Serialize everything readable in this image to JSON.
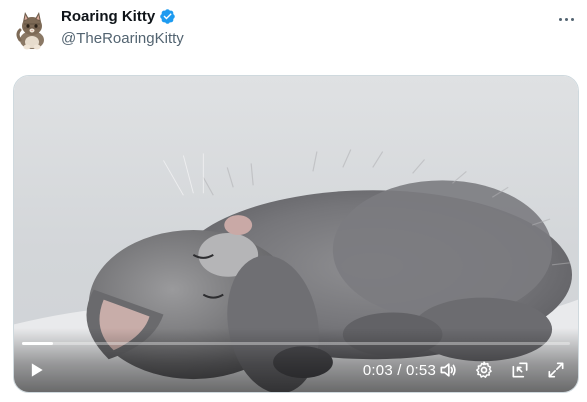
{
  "author": {
    "name": "Roaring Kitty",
    "handle": "@TheRoaringKitty",
    "verified": true,
    "verified_color": "#1d9bf0"
  },
  "header": {
    "more_icon": "more-horizontal-icon"
  },
  "video": {
    "description_icon": "sleeping-kitten-frame",
    "progress": 0.057,
    "current_time": "0:03",
    "duration": "0:53",
    "time_separator": " / ",
    "controls": {
      "play_icon": "play-icon",
      "volume_icon": "volume-icon",
      "settings_icon": "gear-icon",
      "pip_icon": "picture-in-picture-icon",
      "fullscreen_icon": "fullscreen-icon"
    }
  }
}
